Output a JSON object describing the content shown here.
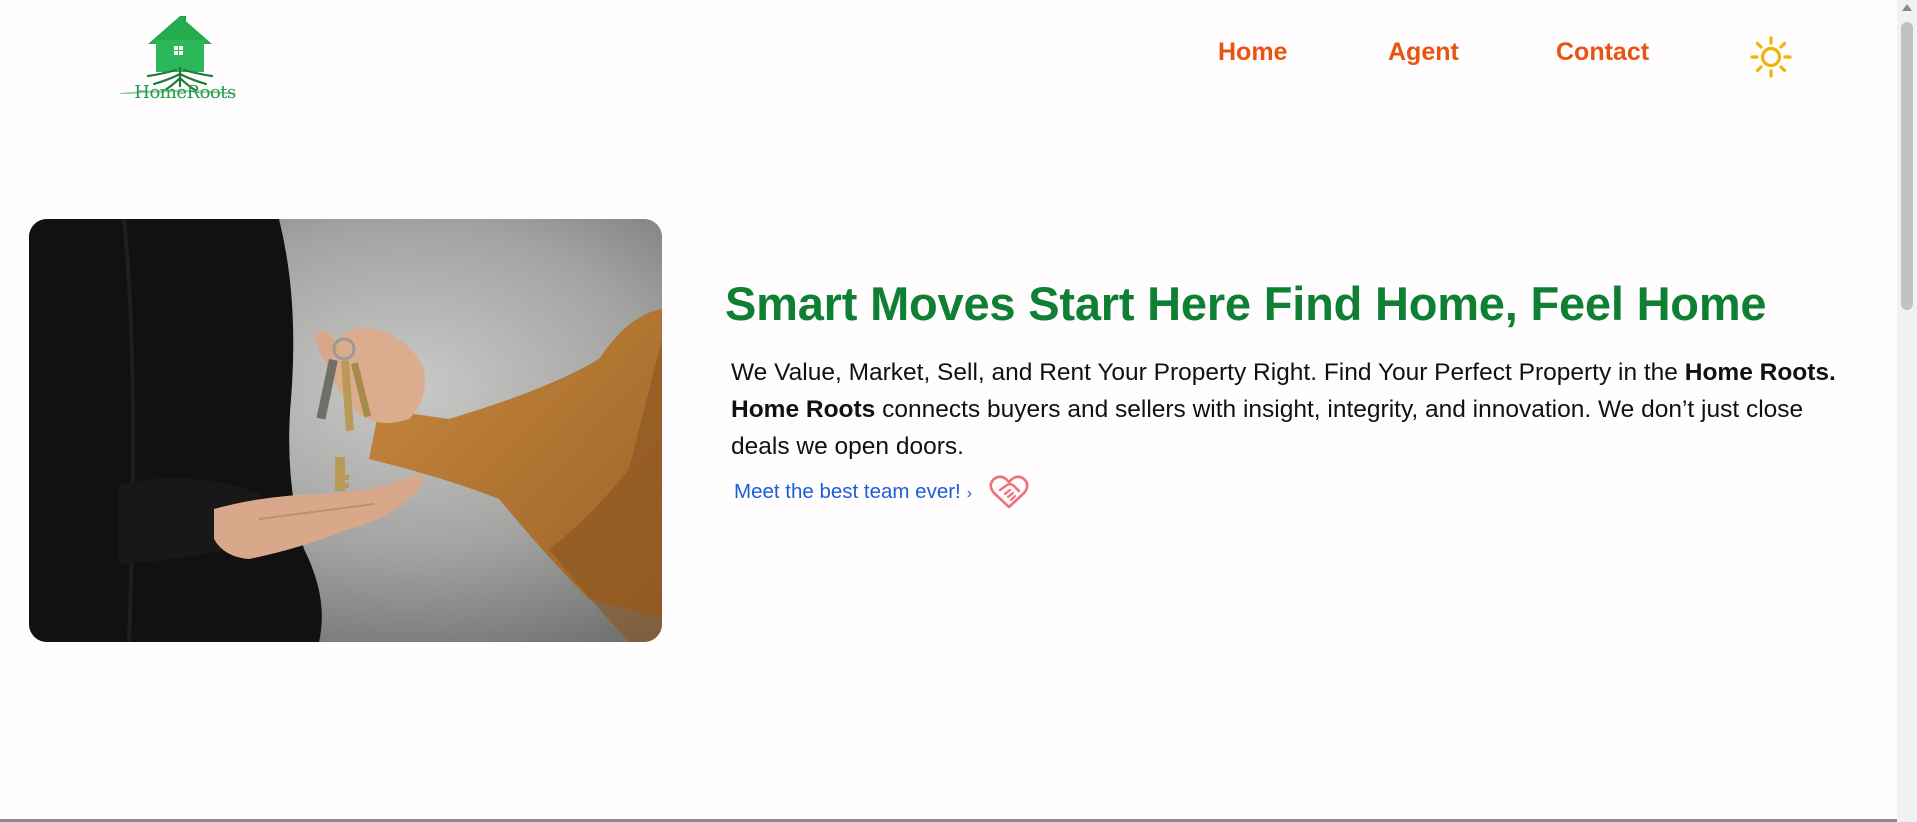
{
  "brand": {
    "logo_text": "HomeRoots"
  },
  "nav": {
    "items": [
      {
        "label": "Home"
      },
      {
        "label": "Agent"
      },
      {
        "label": "Contact"
      }
    ],
    "theme_toggle_icon": "sun-icon",
    "link_color": "#e8540f"
  },
  "hero": {
    "title": "Smart Moves Start Here Find Home, Feel Home",
    "title_color": "#0f7f34",
    "desc_part1": "We Value, Market, Sell, and Rent Your Property Right. Find Your Perfect Property in the ",
    "desc_bold1": "Home Roots.",
    "desc_space": " ",
    "desc_bold2": "Home Roots",
    "desc_part2": " connects buyers and sellers with insight, integrity, and innovation. We don’t just close deals we open doors.",
    "team_link": "Meet the best team ever!",
    "team_link_chevron": "›",
    "team_link_icon": "handshake-heart-icon",
    "image_alt": "key-handover-photo"
  }
}
